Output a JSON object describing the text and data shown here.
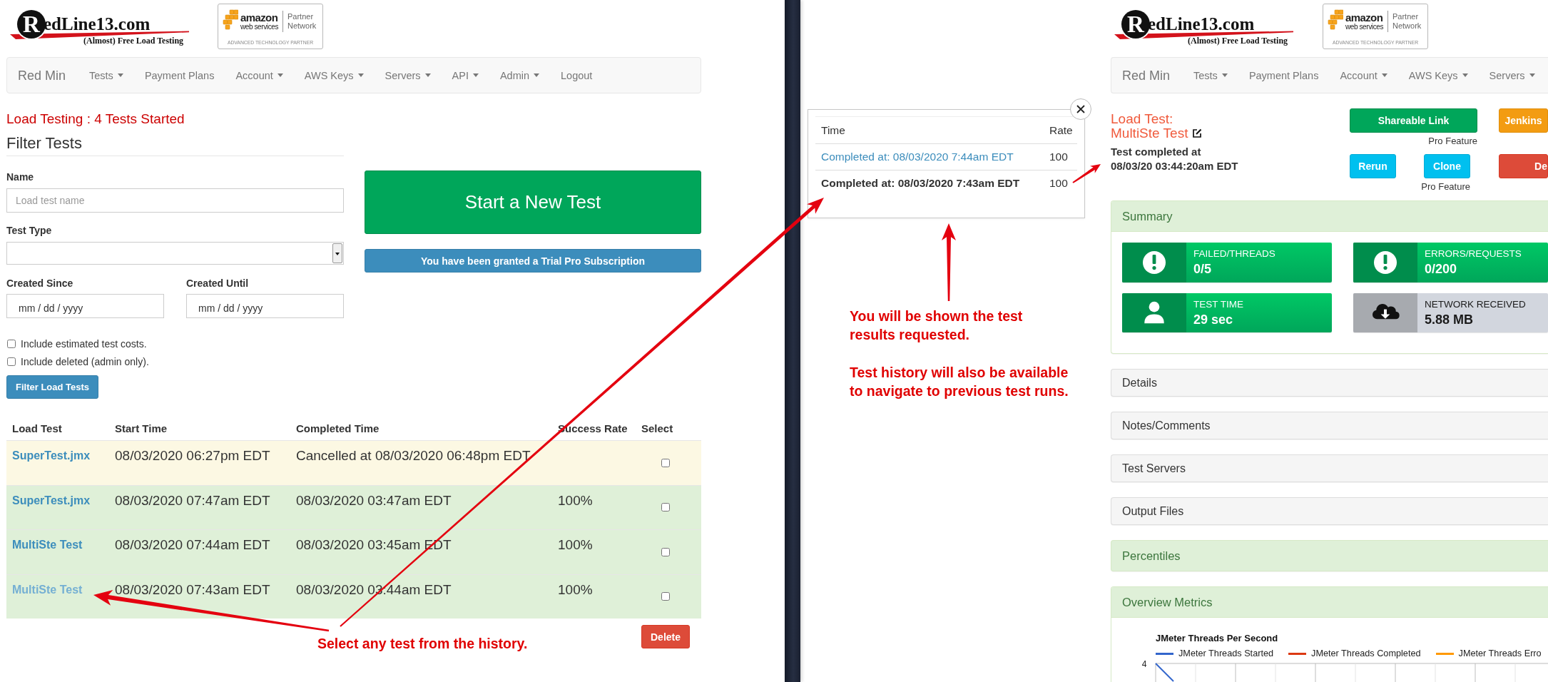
{
  "left_pane": {
    "logo": {
      "initial": "R",
      "wordmark": "edLine13.com",
      "tagline": "(Almost) Free Load Testing"
    },
    "partner_badge": {
      "brand": "amazon",
      "brand_sub": "web services",
      "program": "Partner",
      "program_sub": "Network",
      "tier": "ADVANCED TECHNOLOGY PARTNER"
    },
    "navbar": {
      "brand": "Red Min",
      "items": [
        {
          "label": "Tests",
          "dropdown": true
        },
        {
          "label": "Payment Plans",
          "dropdown": false
        },
        {
          "label": "Account",
          "dropdown": true
        },
        {
          "label": "AWS Keys",
          "dropdown": true
        },
        {
          "label": "Servers",
          "dropdown": true
        },
        {
          "label": "API",
          "dropdown": true
        },
        {
          "label": "Admin",
          "dropdown": true
        },
        {
          "label": "Logout",
          "dropdown": false
        }
      ]
    },
    "status_message": "Load Testing : 4 Tests Started",
    "filter": {
      "title": "Filter Tests",
      "name_field": {
        "label": "Name",
        "placeholder": "Load test name"
      },
      "type_field": {
        "label": "Test Type"
      },
      "date_fields": [
        {
          "label": "Created Since",
          "placeholder": "mm / dd / yyyy"
        },
        {
          "label": "Created Until",
          "placeholder": "mm / dd / yyyy"
        }
      ],
      "options": [
        {
          "label": "Include estimated test costs.",
          "checked": false
        },
        {
          "label": "Include deleted (admin only).",
          "checked": false
        }
      ],
      "submit_button": "Filter Load Tests"
    },
    "start_button": "Start a New Test",
    "notice": "You have been granted a Trial Pro Subscription",
    "tests_table": {
      "columns": [
        "Load Test",
        "Start Time",
        "Completed Time",
        "Success Rate",
        "Select"
      ],
      "rows": [
        {
          "name": "SuperTest.jmx",
          "hovered": false,
          "start_time": "08/03/2020 06:27pm EDT",
          "completed_time": "Cancelled at 08/03/2020 06:48pm EDT",
          "cancelled": true,
          "checked": false
        },
        {
          "name": "SuperTest.jmx",
          "hovered": false,
          "start_time": "08/03/2020 07:47am EDT",
          "completed_time": "08/03/2020 03:47am EDT",
          "success_rate": "100%",
          "cancelled": false,
          "checked": false
        },
        {
          "name": "MultiSte Test",
          "hovered": false,
          "start_time": "08/03/2020 07:44am EDT",
          "completed_time": "08/03/2020 03:45am EDT",
          "success_rate": "100%",
          "cancelled": false,
          "checked": false
        },
        {
          "name": "MultiSte Test",
          "hovered": true,
          "start_time": "08/03/2020 07:43am EDT",
          "completed_time": "08/03/2020 03:44am EDT",
          "success_rate": "100%",
          "cancelled": false,
          "checked": false
        }
      ]
    },
    "delete_button": "Delete",
    "annotation": "Select any test from the history."
  },
  "history_popup": {
    "columns": [
      "Time",
      "Rate"
    ],
    "rows": [
      {
        "time": "Completed at: 08/03/2020 7:44am EDT",
        "rate": "100",
        "selected": false
      },
      {
        "time": "Completed at: 08/03/2020 7:43am EDT",
        "rate": "100",
        "selected": true
      }
    ]
  },
  "annotations": [
    "You will be shown the test\nresults requested.",
    "Test history will also be available\nto navigate to previous test runs."
  ],
  "right_pane": {
    "logo": {
      "initial": "R",
      "wordmark": "edLine13.com",
      "tagline": "(Almost) Free Load Testing"
    },
    "partner_badge": {
      "brand": "amazon",
      "brand_sub": "web services",
      "program": "Partner",
      "program_sub": "Network",
      "tier": "ADVANCED TECHNOLOGY PARTNER"
    },
    "navbar": {
      "brand": "Red Min",
      "items": [
        {
          "label": "Tests",
          "dropdown": true
        },
        {
          "label": "Payment Plans",
          "dropdown": false
        },
        {
          "label": "Account",
          "dropdown": true
        },
        {
          "label": "AWS Keys",
          "dropdown": true
        },
        {
          "label": "Servers",
          "dropdown": true
        }
      ]
    },
    "heading": "Load Test:",
    "test_name": "MultiSte Test",
    "completed_label": "Test completed at",
    "completed_time": "08/03/20 03:44:20am EDT",
    "action_rows": [
      [
        {
          "label": "Shareable Link",
          "kind": "share",
          "note": "Pro Feature"
        },
        {
          "label": "Jenkins",
          "kind": "jenkins"
        }
      ],
      [
        {
          "label": "Rerun",
          "kind": "rerun"
        },
        {
          "label": "Clone",
          "kind": "clone",
          "note": "Pro Feature"
        },
        {
          "label": "De",
          "kind": "delete"
        }
      ]
    ],
    "panels": [
      {
        "title": "Summary",
        "kind": "metrics",
        "expanded": true,
        "tiles": [
          {
            "kind": "alert",
            "label": "FAILED/THREADS",
            "value": "0/5"
          },
          {
            "kind": "alert",
            "label": "ERRORS/REQUESTS",
            "value": "0/200"
          },
          {
            "kind": "person",
            "label": "TEST TIME",
            "value": "29 sec"
          },
          {
            "kind": "download",
            "label": "NETWORK RECEIVED",
            "value": "5.88 MB"
          }
        ]
      },
      {
        "title": "Details",
        "kind": "info",
        "expanded": false
      },
      {
        "title": "Notes/Comments",
        "kind": "info",
        "expanded": false
      },
      {
        "title": "Test Servers",
        "kind": "info",
        "expanded": false
      },
      {
        "title": "Output Files",
        "kind": "info",
        "expanded": false
      },
      {
        "title": "Percentiles",
        "kind": "metrics",
        "expanded": false
      },
      {
        "title": "Overview Metrics",
        "kind": "metrics",
        "expanded": true,
        "chart": {
          "title": "JMeter Threads Per Second",
          "legend": [
            {
              "label": "JMeter Threads Started",
              "color": "#3366cc"
            },
            {
              "label": "JMeter Threads Completed",
              "color": "#dc3912"
            },
            {
              "label": "JMeter Threads Erro",
              "color": "#ff9900"
            }
          ],
          "y_tick": "4"
        }
      }
    ]
  }
}
